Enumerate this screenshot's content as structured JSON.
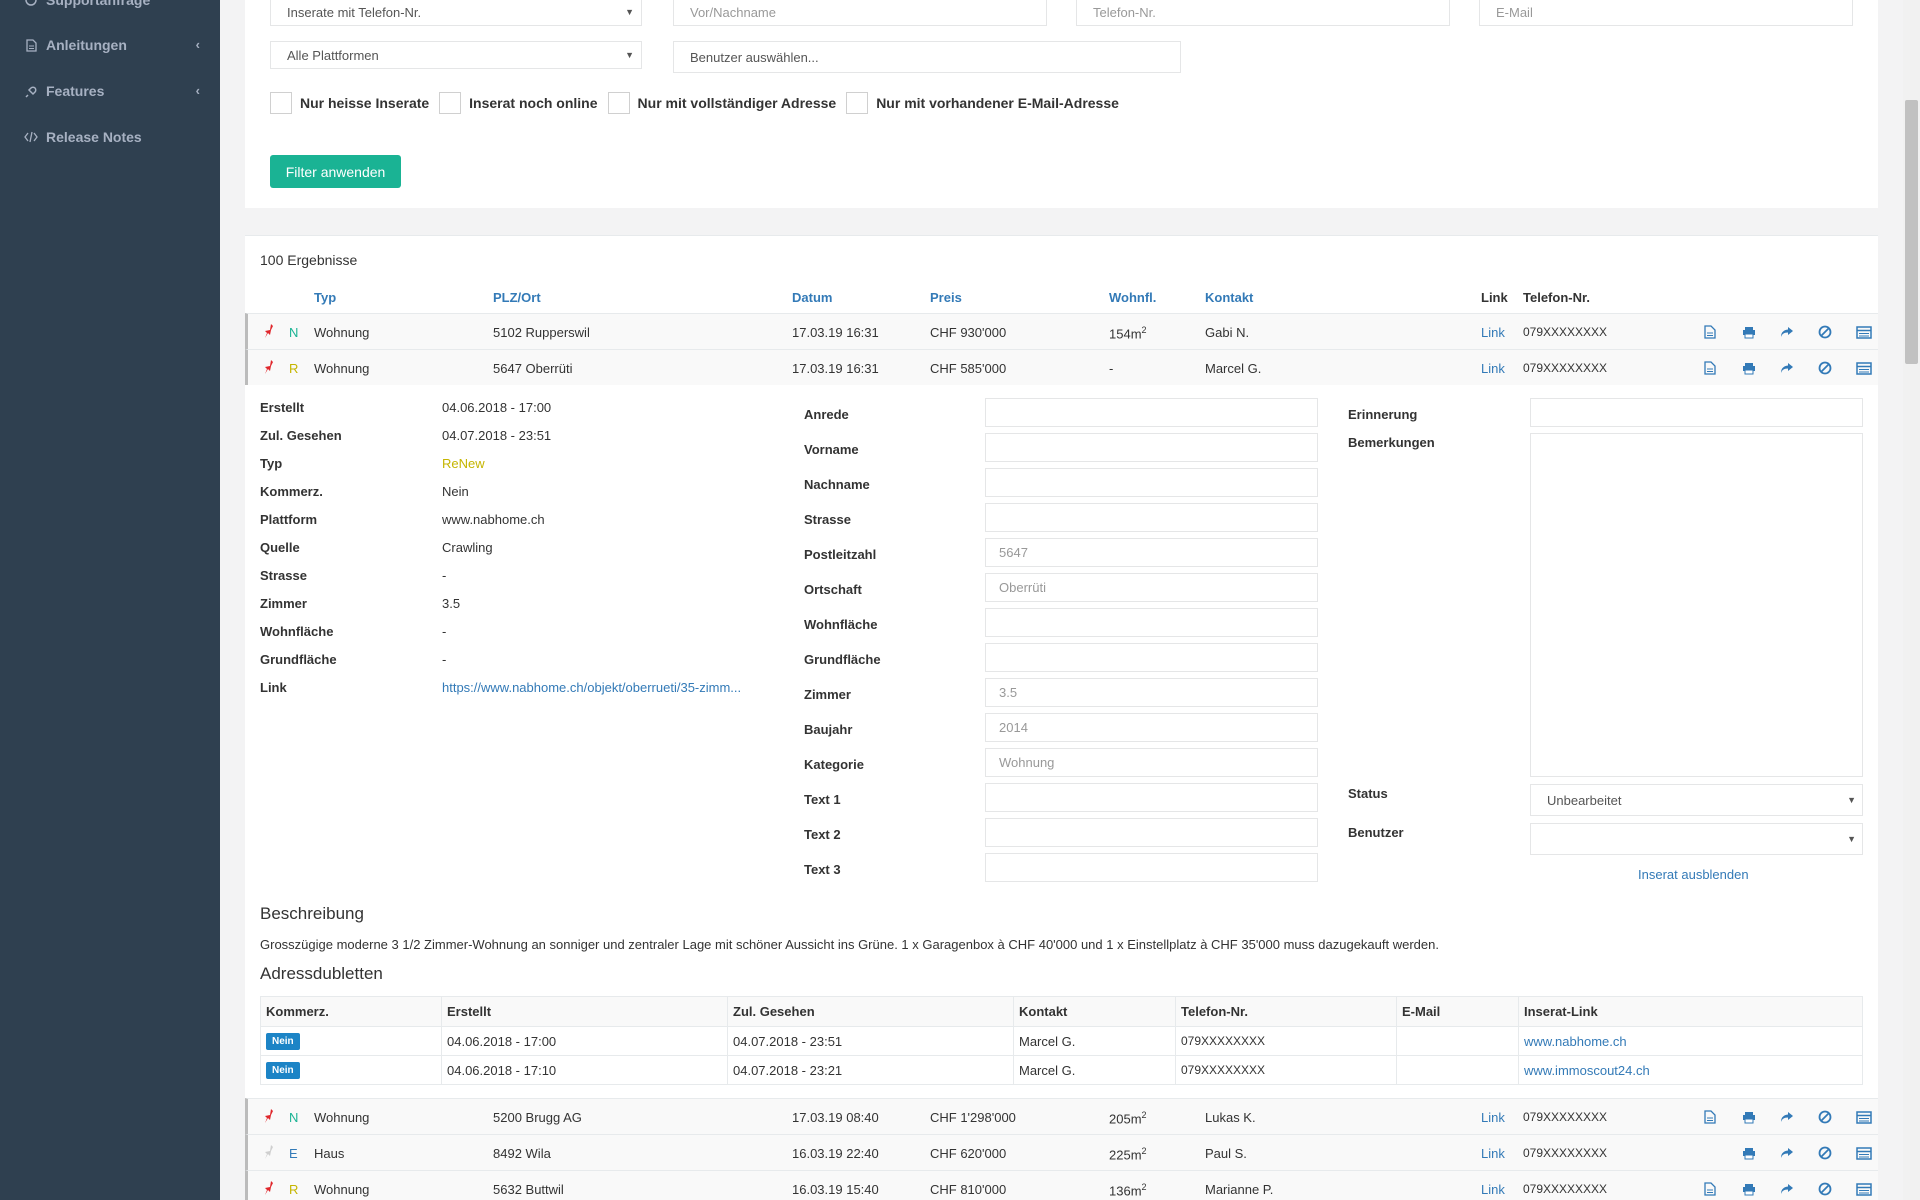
{
  "sidebar": {
    "items": [
      {
        "label": "Supportanfrage"
      },
      {
        "label": "Anleitungen"
      },
      {
        "label": "Features"
      },
      {
        "label": "Release Notes"
      }
    ]
  },
  "filters": {
    "type_select": "Inserate mit Telefon-Nr.",
    "platform_select": "Alle Plattformen",
    "name_placeholder": "Vor/Nachname",
    "phone_placeholder": "Telefon-Nr.",
    "email_placeholder": "E-Mail",
    "user_select": "Benutzer auswählen...",
    "checkboxes": [
      {
        "label": "Nur heisse Inserate"
      },
      {
        "label": "Inserat noch online"
      },
      {
        "label": "Nur mit vollständiger Adresse"
      },
      {
        "label": "Nur mit vorhandener E-Mail-Adresse"
      }
    ],
    "apply_label": "Filter anwenden"
  },
  "results": {
    "count_label": "100 Ergebnisse",
    "headers": {
      "typ": "Typ",
      "plz": "PLZ/Ort",
      "datum": "Datum",
      "preis": "Preis",
      "wohnfl": "Wohnfl.",
      "kontakt": "Kontakt",
      "link": "Link",
      "phone": "Telefon-Nr."
    },
    "rows": [
      {
        "flag": "N",
        "typ": "Wohnung",
        "ort": "5102 Rupperswil",
        "datum": "17.03.19 16:31",
        "preis": "CHF 930'000",
        "wohnfl": "154m",
        "kontakt": "Gabi N.",
        "link": "Link",
        "phone": "079XXXXXXXX"
      },
      {
        "flag": "R",
        "typ": "Wohnung",
        "ort": "5647 Oberrüti",
        "datum": "17.03.19 16:31",
        "preis": "CHF 585'000",
        "wohnfl": "-",
        "kontakt": "Marcel G.",
        "link": "Link",
        "phone": "079XXXXXXXX"
      },
      {
        "flag": "N",
        "typ": "Wohnung",
        "ort": "5200 Brugg AG",
        "datum": "17.03.19 08:40",
        "preis": "CHF 1'298'000",
        "wohnfl": "205m",
        "kontakt": "Lukas K.",
        "link": "Link",
        "phone": "079XXXXXXXX"
      },
      {
        "flag": "E",
        "typ": "Haus",
        "ort": "8492 Wila",
        "datum": "16.03.19 22:40",
        "preis": "CHF 620'000",
        "wohnfl": "225m",
        "kontakt": "Paul S.",
        "link": "Link",
        "phone": "079XXXXXXXX"
      },
      {
        "flag": "R",
        "typ": "Wohnung",
        "ort": "5632 Buttwil",
        "datum": "16.03.19 15:40",
        "preis": "CHF 810'000",
        "wohnfl": "136m",
        "kontakt": "Marianne P.",
        "link": "Link",
        "phone": "079XXXXXXXX"
      }
    ],
    "sq": "2"
  },
  "detail": {
    "info": [
      {
        "label": "Erstellt",
        "value": "04.06.2018 - 17:00"
      },
      {
        "label": "Zul. Gesehen",
        "value": "04.07.2018 - 23:51"
      },
      {
        "label": "Typ",
        "value": "ReNew"
      },
      {
        "label": "Kommerz.",
        "value": "Nein"
      },
      {
        "label": "Plattform",
        "value": "www.nabhome.ch"
      },
      {
        "label": "Quelle",
        "value": "Crawling"
      },
      {
        "label": "Strasse",
        "value": "-"
      },
      {
        "label": "Zimmer",
        "value": "3.5"
      },
      {
        "label": "Wohnfläche",
        "value": "-"
      },
      {
        "label": "Grundfläche",
        "value": "-"
      },
      {
        "label": "Link",
        "value": "https://www.nabhome.ch/objekt/oberrueti/35-zimm..."
      }
    ],
    "fields": [
      {
        "label": "Anrede",
        "value": ""
      },
      {
        "label": "Vorname",
        "value": ""
      },
      {
        "label": "Nachname",
        "value": ""
      },
      {
        "label": "Strasse",
        "value": ""
      },
      {
        "label": "Postleitzahl",
        "value": "5647"
      },
      {
        "label": "Ortschaft",
        "value": "Oberrüti"
      },
      {
        "label": "Wohnfläche",
        "value": ""
      },
      {
        "label": "Grundfläche",
        "value": ""
      },
      {
        "label": "Zimmer",
        "value": "3.5"
      },
      {
        "label": "Baujahr",
        "value": "2014"
      },
      {
        "label": "Kategorie",
        "value": "Wohnung"
      },
      {
        "label": "Text 1",
        "value": ""
      },
      {
        "label": "Text 2",
        "value": ""
      },
      {
        "label": "Text 3",
        "value": ""
      }
    ],
    "erinnerung_label": "Erinnerung",
    "bemerkungen_label": "Bemerkungen",
    "status_label": "Status",
    "status_value": "Unbearbeitet",
    "benutzer_label": "Benutzer",
    "hide_link": "Inserat ausblenden",
    "beschreibung_title": "Beschreibung",
    "beschreibung_text": "Grosszügige moderne 3 1/2 Zimmer-Wohnung an sonniger und zentraler Lage mit schöner Aussicht ins Grüne. 1 x Garagenbox à CHF 40'000 und 1 x Einstellplatz à CHF 35'000 muss dazugekauft werden.",
    "dubletten_title": "Adressdubletten",
    "dup_headers": [
      "Kommerz.",
      "Erstellt",
      "Zul. Gesehen",
      "Kontakt",
      "Telefon-Nr.",
      "E-Mail",
      "Inserat-Link"
    ],
    "dup_rows": [
      {
        "kommerz": "Nein",
        "erstellt": "04.06.2018 - 17:00",
        "gesehen": "04.07.2018 - 23:51",
        "kontakt": "Marcel G.",
        "phone": "079XXXXXXXX",
        "email": "",
        "link": "www.nabhome.ch"
      },
      {
        "kommerz": "Nein",
        "erstellt": "04.06.2018 - 17:10",
        "gesehen": "04.07.2018 - 23:21",
        "kontakt": "Marcel G.",
        "phone": "079XXXXXXXX",
        "email": "",
        "link": "www.immoscout24.ch"
      }
    ]
  },
  "colors": {
    "sidebar_bg": "#2f4050",
    "primary": "#1ab394",
    "link": "#337ab7",
    "pin_red": "#e0262b"
  },
  "icons": [
    "file-icon",
    "print-icon",
    "share-icon",
    "ban-icon",
    "list-icon",
    "pin-icon"
  ]
}
